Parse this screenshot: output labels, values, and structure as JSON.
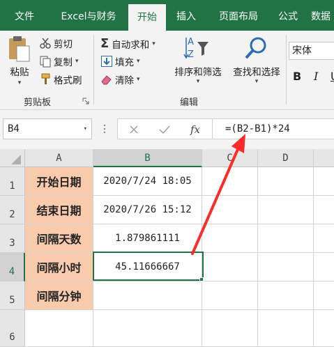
{
  "tabs": [
    {
      "label": "文件",
      "active": false
    },
    {
      "label": "Excel与财务",
      "active": false
    },
    {
      "label": "开始",
      "active": true
    },
    {
      "label": "插入",
      "active": false
    },
    {
      "label": "页面布局",
      "active": false
    },
    {
      "label": "公式",
      "active": false
    },
    {
      "label": "数据",
      "active": false
    }
  ],
  "ribbon": {
    "clipboard": {
      "paste": "粘贴",
      "cut": "剪切",
      "copy": "复制",
      "format_painter": "格式刷",
      "group_label": "剪贴板"
    },
    "editing": {
      "autosum": "自动求和",
      "fill": "填充",
      "clear": "清除",
      "sort_filter": "排序和筛选",
      "find_select": "查找和选择",
      "group_label": "编辑"
    },
    "font": {
      "font_name": "宋体",
      "bold": "B",
      "italic": "I",
      "underline": "U"
    }
  },
  "formula_bar": {
    "name_box": "B4",
    "fx": "fx",
    "formula": "=(B2-B1)*24"
  },
  "grid": {
    "columns": [
      "A",
      "B",
      "C",
      "D"
    ],
    "selected_column": "B",
    "rows": [
      {
        "num": "1",
        "label": "开始日期",
        "value": "2020/7/24 18:05",
        "align": "left"
      },
      {
        "num": "2",
        "label": "结束日期",
        "value": "2020/7/26 15:12",
        "align": "left"
      },
      {
        "num": "3",
        "label": "间隔天数",
        "value": "1.879861111",
        "align": "right"
      },
      {
        "num": "4",
        "label": "间隔小时",
        "value": "45.11666667",
        "align": "right"
      },
      {
        "num": "5",
        "label": "间隔分钟",
        "value": "",
        "align": "right"
      },
      {
        "num": "6",
        "label": "",
        "value": "",
        "align": "right"
      }
    ],
    "selected_row": "4"
  },
  "colors": {
    "excel_green": "#217346",
    "label_fill": "#f8cbad",
    "annotation_arrow": "#ff2a2a"
  }
}
